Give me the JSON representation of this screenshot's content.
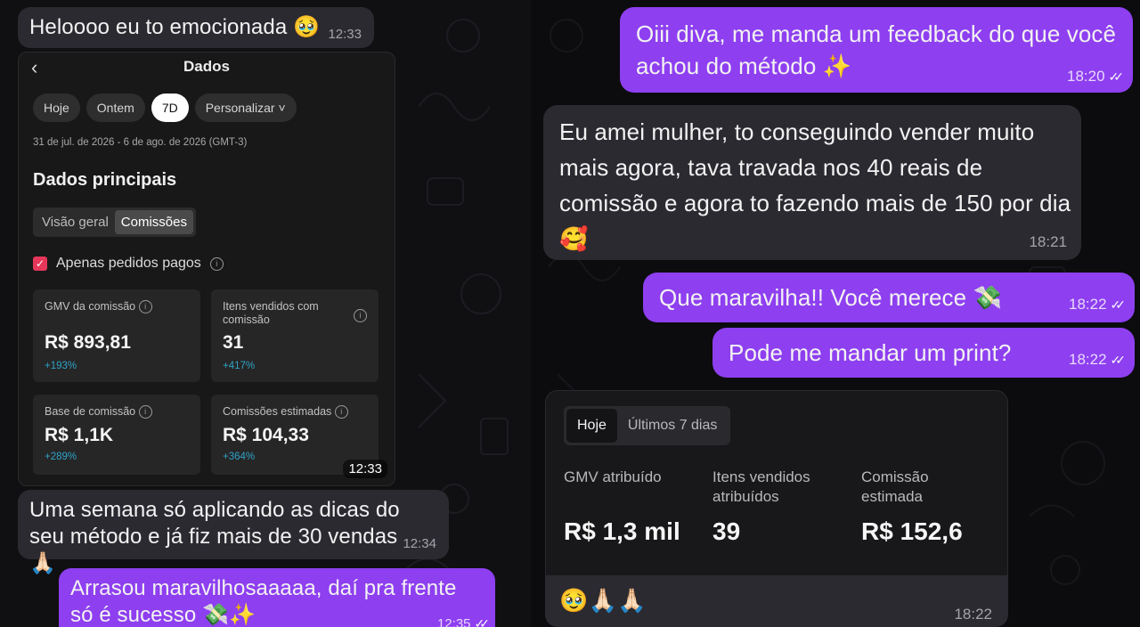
{
  "left_chat": {
    "msg1": {
      "text": "Heloooo eu to emocionada 🥹",
      "time": "12:33"
    },
    "screenshot": {
      "title": "Dados",
      "chips": [
        "Hoje",
        "Ontem",
        "7D",
        "Personalizar"
      ],
      "range": "31 de jul. de 2026 - 6 de ago. de 2026 (GMT-3)",
      "heading": "Dados principais",
      "tabs": [
        "Visão geral",
        "Comissões"
      ],
      "checkbox_label": "Apenas pedidos pagos",
      "cards": [
        {
          "label": "GMV da comissão",
          "value": "R$ 893,81",
          "pct": "+193%"
        },
        {
          "label": "Itens vendidos com comissão",
          "value": "31",
          "pct": "+417%"
        },
        {
          "label": "Base de comissão",
          "value": "R$ 1,1K",
          "pct": "+289%"
        },
        {
          "label": "Comissões estimadas",
          "value": "R$ 104,33",
          "pct": "+364%"
        }
      ],
      "time": "12:33"
    },
    "msg2": {
      "text": "Uma semana só aplicando as dicas do seu método e já fiz mais de 30 vendas🙏🏻",
      "time": "12:34"
    },
    "msg3": {
      "text": "Arrasou maravilhosaaaaa, daí pra frente só é sucesso 💸✨",
      "time": "12:35"
    }
  },
  "right_chat": {
    "msg1": {
      "text": "Oiii diva, me manda um feedback do que você achou do método ✨",
      "time": "18:20"
    },
    "msg2": {
      "text": "Eu amei mulher, to conseguindo vender muito mais agora, tava travada nos 40 reais de comissão e agora to fazendo mais de 150 por dia 🥰",
      "time": "18:21"
    },
    "msg3": {
      "text": "Que maravilha!! Você merece 💸",
      "time": "18:22"
    },
    "msg4": {
      "text": "Pode me mandar um print?",
      "time": "18:22"
    },
    "stats": {
      "tabs": [
        "Hoje",
        "Últimos 7 dias"
      ],
      "cols": [
        {
          "label": "GMV atribuído",
          "value": "R$ 1,3 mil"
        },
        {
          "label": "Itens vendidos atribuídos",
          "value": "39"
        },
        {
          "label": "Comissão estimada",
          "value": "R$ 152,6"
        }
      ],
      "caption": "🥹🙏🏻🙏🏻",
      "time": "18:22"
    }
  },
  "colors": {
    "incoming": "#2b2a31",
    "outgoing": "#8e3ff0",
    "accent_red": "#e6375a",
    "growth_blue": "#2fa3c8"
  }
}
